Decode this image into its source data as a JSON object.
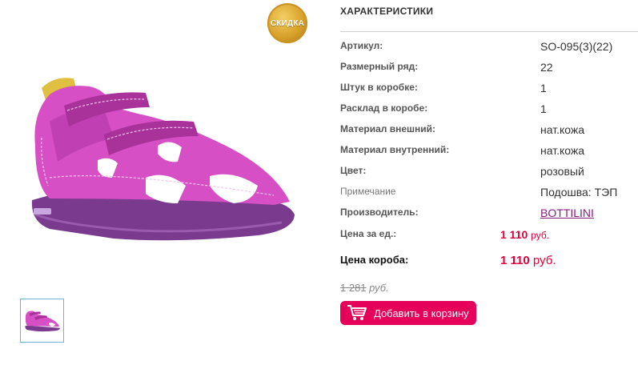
{
  "badge": {
    "text": "СКИДКА"
  },
  "specs": {
    "title": "ХАРАКТЕРИСТИКИ",
    "rows": [
      {
        "label": "Артикул:",
        "value": "SO-095(3)(22)"
      },
      {
        "label": "Размерный ряд:",
        "value": "22"
      },
      {
        "label": "Штук в коробке:",
        "value": "1"
      },
      {
        "label": "Расклад в коробе:",
        "value": "1"
      },
      {
        "label": "Материал внешний:",
        "value": "нат.кожа"
      },
      {
        "label": "Материал внутренний:",
        "value": "нат.кожа"
      },
      {
        "label": "Цвет:",
        "value": "розовый"
      },
      {
        "label": "Примечание",
        "value": "Подошва: ТЭП"
      },
      {
        "label": "Производитель:",
        "value": "BOTTILINI"
      }
    ]
  },
  "pricing": {
    "unit_label": "Цена за ед.:",
    "unit_price": "1 110",
    "unit_currency": "руб.",
    "box_label": "Цена короба:",
    "box_price": "1 110",
    "box_currency": "руб.",
    "old_price": "1 281",
    "old_currency": "руб."
  },
  "cart": {
    "label": "Добавить в корзину",
    "icon": "cart-icon"
  },
  "colors": {
    "accent": "#e5005a",
    "price": "#e4003d",
    "link": "#8a1c7c",
    "badge": "#d8a12a"
  }
}
